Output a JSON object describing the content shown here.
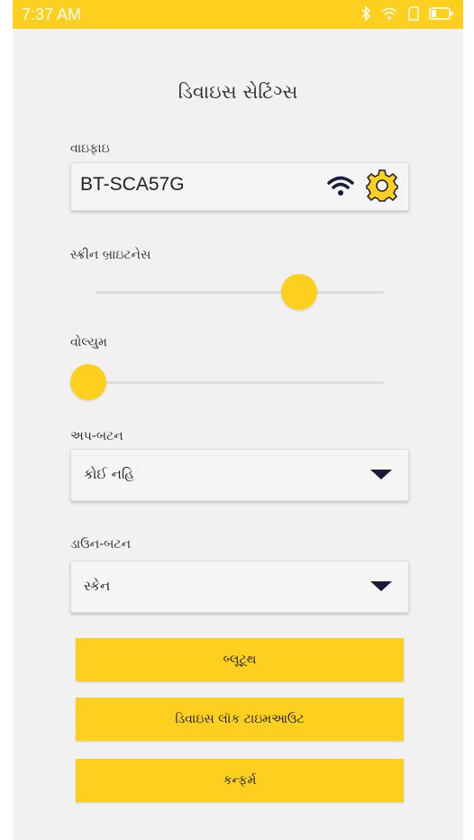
{
  "status_bar": {
    "time": "7:37 AM",
    "icons": [
      "bluetooth-icon",
      "wifi-signal-icon",
      "sim-icon",
      "battery-icon"
    ],
    "color": "#FDD01F"
  },
  "page": {
    "title": "ડિવાઇસ સેટિંગ્સ"
  },
  "wifi": {
    "label": "વાઇફાઇ",
    "network_name": "BT-SCA57G",
    "icons": [
      "wifi-icon",
      "gear-icon"
    ]
  },
  "brightness": {
    "label": "સ્ક્રીન બ્રાઇટનેસ",
    "level": 0.76
  },
  "volume": {
    "label": "વોલ્યુમ",
    "level": 0.0
  },
  "up_button": {
    "label": "અપ-બટન",
    "selected": "કોઈ નહિ"
  },
  "down_button": {
    "label": "ડાઉન-બટન",
    "selected": "સ્કેન"
  },
  "buttons": {
    "bluetooth": "બ્લૂટૂથ",
    "lock_timeout": "ડિવાઇસ લૉક ટાઇમઆઉટ",
    "confirm": "કન્ફર્મ"
  },
  "colors": {
    "accent": "#FDD01F",
    "background": "#f1f1f1"
  }
}
